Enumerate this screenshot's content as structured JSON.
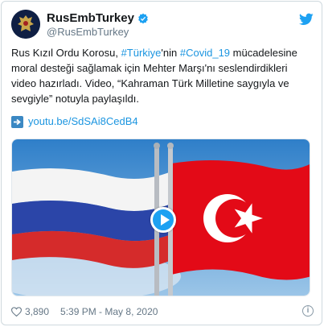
{
  "tweet": {
    "display_name": "RusEmbTurkey",
    "handle": "@RusEmbTurkey",
    "text_parts": {
      "p1": "Rus Kızıl Ordu Korosu, ",
      "hashtag1": "#Türkiye",
      "p2": "'nin ",
      "hashtag2": "#Covid_19",
      "p3": " mücadelesine moral desteği sağlamak için Mehter Marşı'nı seslendirdikleri video hazırladı. Video, “Kahraman Türk Milletine saygıyla ve sevgiyle” notuyla paylaşıldı."
    },
    "link_text": "youtu.be/SdSAi8CedB4",
    "likes": "3,890",
    "timestamp": "5:39 PM - May 8, 2020",
    "info_glyph": "i"
  },
  "icons": {
    "verified": "verified-badge-icon",
    "twitter": "twitter-bird-icon",
    "arrow": "right-arrow-emoji-icon",
    "like": "heart-icon",
    "play": "play-icon",
    "info": "info-icon"
  },
  "colors": {
    "link": "#1b95e0",
    "twitter_blue": "#1da1f2",
    "turkey_red": "#e30a17"
  }
}
